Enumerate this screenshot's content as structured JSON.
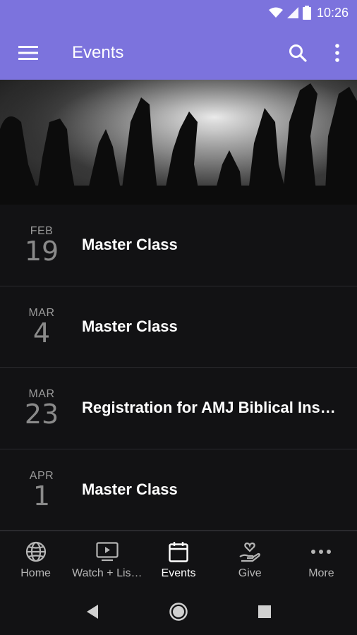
{
  "status_bar": {
    "time": "10:26"
  },
  "app_bar": {
    "title": "Events"
  },
  "events": [
    {
      "month": "FEB",
      "day": "19",
      "title": "Master Class"
    },
    {
      "month": "MAR",
      "day": "4",
      "title": "Master Class"
    },
    {
      "month": "MAR",
      "day": "23",
      "title": "Registration for AMJ Biblical Ins…"
    },
    {
      "month": "APR",
      "day": "1",
      "title": "Master Class"
    }
  ],
  "bottom_nav": {
    "items": [
      {
        "label": "Home",
        "icon": "globe-icon"
      },
      {
        "label": "Watch + Lis…",
        "icon": "video-play-icon"
      },
      {
        "label": "Events",
        "icon": "calendar-icon"
      },
      {
        "label": "Give",
        "icon": "hand-heart-icon"
      },
      {
        "label": "More",
        "icon": "more-horizontal-icon"
      }
    ],
    "active": "Events"
  },
  "colors": {
    "accent": "#7c73dd",
    "background": "#121214",
    "divider": "#2a2a2e"
  }
}
